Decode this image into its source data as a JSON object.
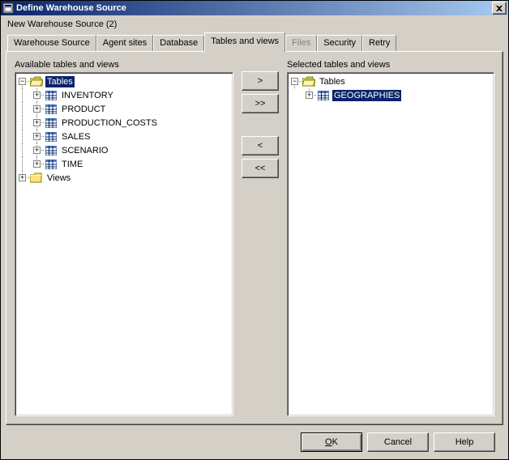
{
  "window": {
    "title": "Define Warehouse Source",
    "subtitle": "New Warehouse Source (2)"
  },
  "tabs": [
    {
      "label": "Warehouse Source",
      "active": false,
      "disabled": false
    },
    {
      "label": "Agent sites",
      "active": false,
      "disabled": false
    },
    {
      "label": "Database",
      "active": false,
      "disabled": false
    },
    {
      "label": "Tables and views",
      "active": true,
      "disabled": false
    },
    {
      "label": "Files",
      "active": false,
      "disabled": true
    },
    {
      "label": "Security",
      "active": false,
      "disabled": false
    },
    {
      "label": "Retry",
      "active": false,
      "disabled": false
    }
  ],
  "panel": {
    "left_label": "Available tables and views",
    "right_label": "Selected tables and views"
  },
  "move_buttons": {
    "add": ">",
    "add_all": ">>",
    "remove": "<",
    "remove_all": "<<"
  },
  "left_tree": {
    "root": [
      {
        "label": "Tables",
        "icon": "folder-open",
        "expanded": true,
        "selected": true,
        "children": [
          {
            "label": "INVENTORY",
            "icon": "table",
            "hasChildren": true
          },
          {
            "label": "PRODUCT",
            "icon": "table",
            "hasChildren": true
          },
          {
            "label": "PRODUCTION_COSTS",
            "icon": "table",
            "hasChildren": true
          },
          {
            "label": "SALES",
            "icon": "table",
            "hasChildren": true
          },
          {
            "label": "SCENARIO",
            "icon": "table",
            "hasChildren": true
          },
          {
            "label": "TIME",
            "icon": "table",
            "hasChildren": true
          }
        ]
      },
      {
        "label": "Views",
        "icon": "folder-closed",
        "expanded": false,
        "selected": false,
        "hasChildren": true
      }
    ]
  },
  "right_tree": {
    "root": [
      {
        "label": "Tables",
        "icon": "folder-open",
        "expanded": true,
        "selected": false,
        "children": [
          {
            "label": "GEOGRAPHIES",
            "icon": "table",
            "hasChildren": true,
            "selected": true
          }
        ]
      }
    ]
  },
  "footer": {
    "ok": "OK",
    "cancel": "Cancel",
    "help": "Help"
  }
}
